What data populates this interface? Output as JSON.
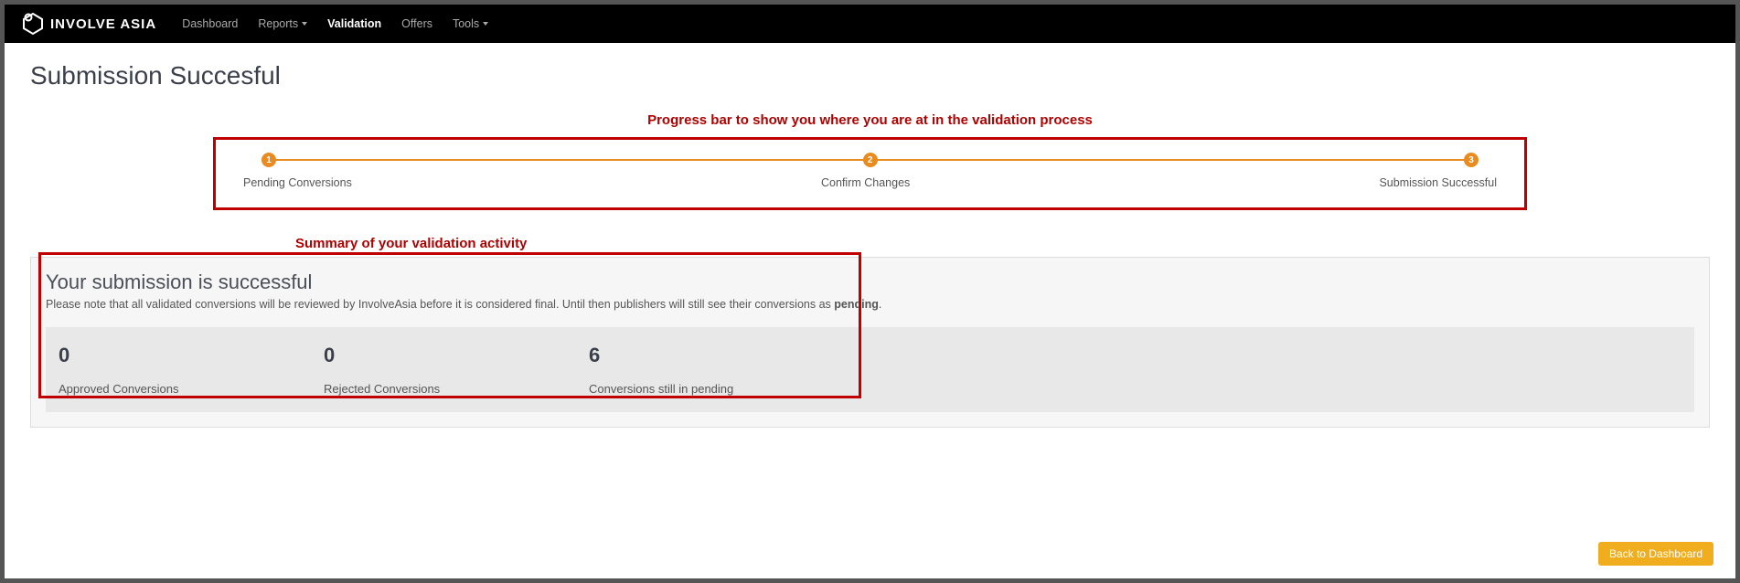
{
  "brand": "INVOLVE ASIA",
  "nav": {
    "dashboard": "Dashboard",
    "reports": "Reports",
    "validation": "Validation",
    "offers": "Offers",
    "tools": "Tools"
  },
  "page_title": "Submission Succesful",
  "annotations": {
    "progress": "Progress bar to show you where you are at in the validation process",
    "summary": "Summary of your validation activity"
  },
  "progress": {
    "steps": [
      {
        "num": "1",
        "label": "Pending Conversions"
      },
      {
        "num": "2",
        "label": "Confirm Changes"
      },
      {
        "num": "3",
        "label": "Submission Successful"
      }
    ]
  },
  "summary": {
    "title": "Your submission is successful",
    "note_pre": "Please note that all validated conversions will be reviewed by InvolveAsia before it is considered final. Until then publishers will still see their conversions as ",
    "note_bold": "pending",
    "note_post": "."
  },
  "stats": [
    {
      "value": "0",
      "label": "Approved Conversions"
    },
    {
      "value": "0",
      "label": "Rejected Conversions"
    },
    {
      "value": "6",
      "label": "Conversions still in pending"
    }
  ],
  "back_button": "Back to Dashboard"
}
